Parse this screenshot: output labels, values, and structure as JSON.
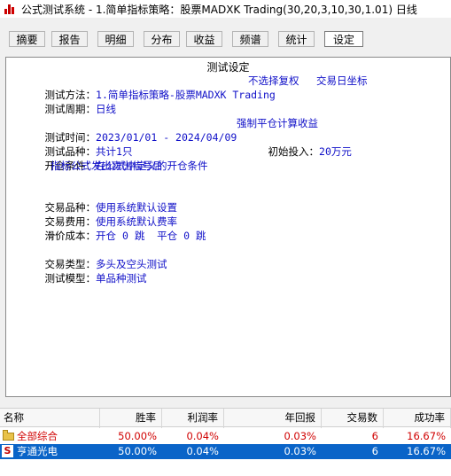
{
  "window": {
    "title": "公式测试系统 - 1.简单指标策略：股票MADXK Trading(30,20,3,10,30,1.01) 日线"
  },
  "tabs": [
    {
      "label": "摘要"
    },
    {
      "label": "报告"
    },
    {
      "label": "明细"
    },
    {
      "label": "分布"
    },
    {
      "label": "收益"
    },
    {
      "label": "频谱"
    },
    {
      "label": "统计"
    },
    {
      "label": "设定",
      "active": true
    }
  ],
  "settings": {
    "heading": "测试设定",
    "method_label": "测试方法：",
    "method_value": "1.简单指标策略-股票MADXK Trading",
    "no_restore": "不选择复权",
    "trade_day_axis": "交易日坐标",
    "period_label": "测试周期：",
    "period_value": "日线",
    "time_label": "测试时间：",
    "time_value": "2023/01/01 - 2024/04/09",
    "force_close": "强制平仓计算收益",
    "variety_label": "测试品种：",
    "variety_value": "共计1只",
    "initial_label": "初始投入：",
    "initial_value": "20万元",
    "open_label": "开仓条件：",
    "open_value1": "在公式中定义的开仓条件",
    "open_value2": "指标公式发出卖出信号后",
    "trade_variety_label": "交易品种：",
    "trade_variety_value": "使用系统默认设置",
    "fee_label": "交易费用：",
    "fee_value": "使用系统默认费率",
    "slip_label": "滑价成本：",
    "slip_value": "开仓 0 跳  平仓 0 跳",
    "trade_type_label": "交易类型：",
    "trade_type_value": "多头及空头测试",
    "model_label": "测试模型：",
    "model_value": "单品种测试"
  },
  "table": {
    "headers": [
      "名称",
      "胜率",
      "利润率",
      "年回报",
      "交易数",
      "成功率"
    ],
    "rows": [
      {
        "name": "全部综合",
        "win_rate": "50.00%",
        "profit": "0.04%",
        "annual": "0.03%",
        "trades": "6",
        "success": "16.67%",
        "icon": "folder-icon"
      },
      {
        "name": "亨通光电",
        "win_rate": "50.00%",
        "profit": "0.04%",
        "annual": "0.03%",
        "trades": "6",
        "success": "16.67%",
        "icon": "s-badge-icon"
      }
    ]
  },
  "colors": {
    "value_blue": "#1010c8",
    "summary_red": "#d00000",
    "selected_row": "#0a64c8"
  }
}
